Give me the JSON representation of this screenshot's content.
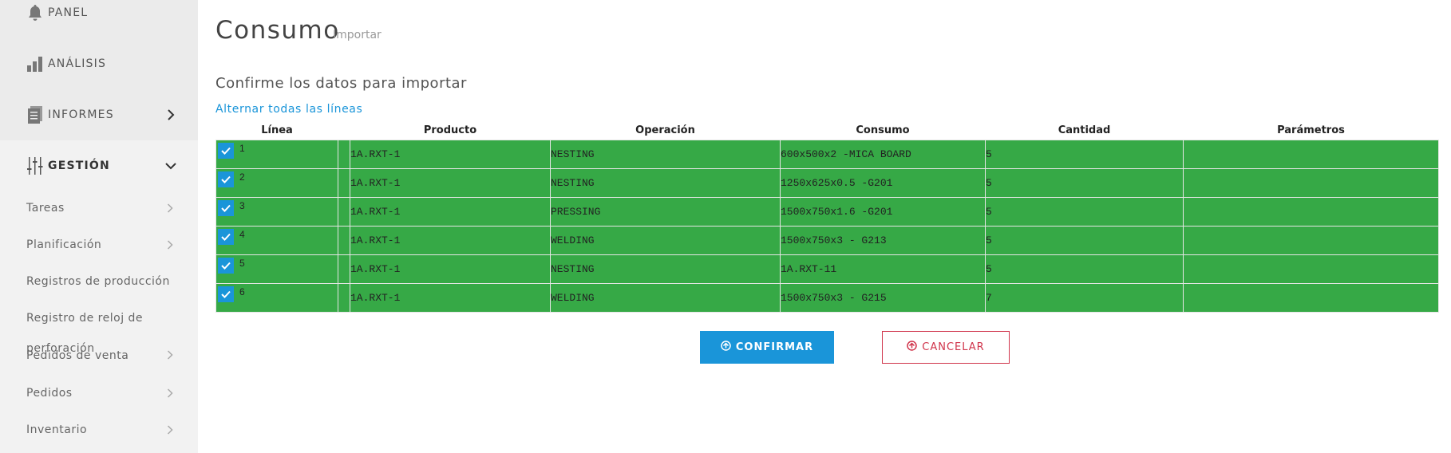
{
  "sidebar": {
    "sections": [
      {
        "label": "PANEL",
        "icon": "bell-icon"
      },
      {
        "label": "ANÁLISIS",
        "icon": "bar-chart-icon"
      },
      {
        "label": "INFORMES",
        "icon": "report-icon",
        "chevron": "chevron-right-icon"
      },
      {
        "label": "GESTIÓN",
        "icon": "sliders-icon",
        "chevron": "chevron-down-icon"
      }
    ],
    "items": [
      {
        "label": "Tareas"
      },
      {
        "label": "Planificación"
      },
      {
        "label": "Registros de producción"
      },
      {
        "label": "Registro de reloj de"
      },
      {
        "label": "perforación"
      },
      {
        "label": "Pedidos de venta"
      },
      {
        "label": "Pedidos"
      },
      {
        "label": "Inventario"
      }
    ]
  },
  "header": {
    "title": "Consumo",
    "subtitle": "Importar"
  },
  "main": {
    "heading": "Confirme los datos para importar",
    "toggle_all": "Alternar todas las líneas",
    "columns": [
      "Línea",
      "Producto",
      "Operación",
      "Consumo",
      "Cantidad",
      "Parámetros"
    ],
    "row_color": "#36a946",
    "rows": [
      {
        "line": "1",
        "product": "1A.RXT-1",
        "operation": "NESTING",
        "consumption": "600x500x2 -MICA BOARD",
        "qty": "5",
        "params": "",
        "checked": true
      },
      {
        "line": "2",
        "product": "1A.RXT-1",
        "operation": "NESTING",
        "consumption": "1250x625x0.5 -G201",
        "qty": "5",
        "params": "",
        "checked": true
      },
      {
        "line": "3",
        "product": "1A.RXT-1",
        "operation": "PRESSING",
        "consumption": "1500x750x1.6 -G201",
        "qty": "5",
        "params": "",
        "checked": true
      },
      {
        "line": "4",
        "product": "1A.RXT-1",
        "operation": "WELDING",
        "consumption": "1500x750x3 - G213",
        "qty": "5",
        "params": "",
        "checked": true
      },
      {
        "line": "5",
        "product": "1A.RXT-1",
        "operation": "NESTING",
        "consumption": "1A.RXT-11",
        "qty": "5",
        "params": "",
        "checked": true
      },
      {
        "line": "6",
        "product": "1A.RXT-1",
        "operation": "WELDING",
        "consumption": "1500x750x3 - G215",
        "qty": "7",
        "params": "",
        "checked": true
      }
    ]
  },
  "actions": {
    "confirm": "CONFIRMAR",
    "cancel": "CANCELAR",
    "confirm_color": "#1a95d9",
    "cancel_color": "#d0344b"
  }
}
